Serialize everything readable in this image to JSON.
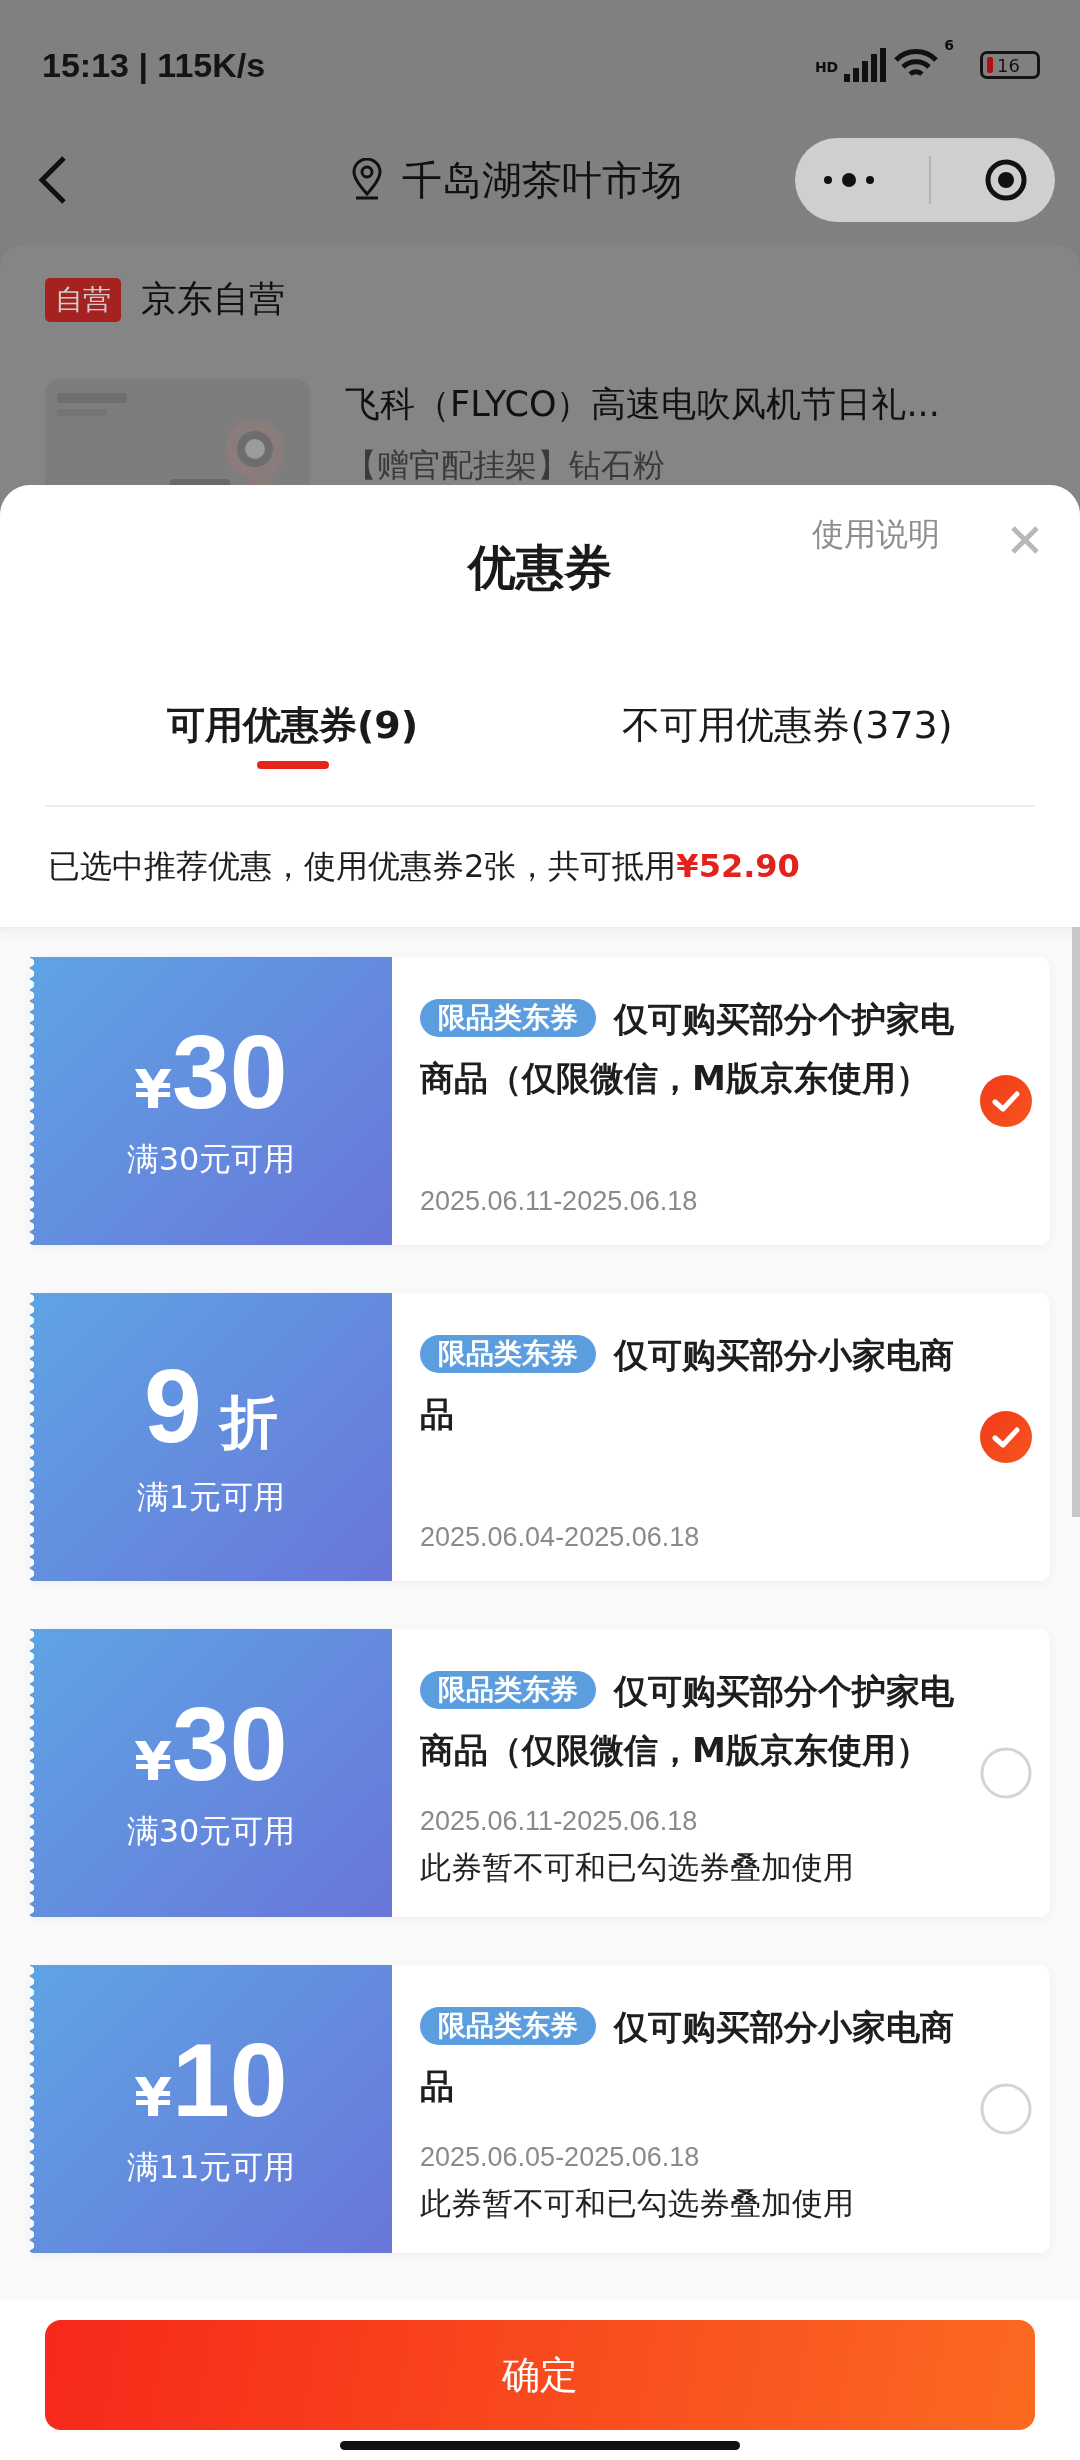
{
  "status_bar": {
    "time": "15:13 | 115K/s",
    "network": "HD",
    "wifi_badge": "6",
    "battery": "16"
  },
  "header": {
    "title": "千岛湖茶叶市场"
  },
  "background_page": {
    "badge": "自营",
    "store": "京东自营",
    "product": {
      "title": "飞科（FLYCO）高速电吹风机节日礼...",
      "subtitle": "【赠官配挂架】钻石粉"
    }
  },
  "sheet": {
    "help_link": "使用说明",
    "title": "优惠券",
    "tabs": [
      {
        "label": "可用优惠券(9)",
        "selected": true
      },
      {
        "label": "不可用优惠券(373)",
        "selected": false
      }
    ],
    "summary": {
      "text": "已选中推荐优惠，使用优惠券2张，共可抵用",
      "amount": "¥52.90"
    },
    "coupons": [
      {
        "kind": "cash",
        "currency": "¥",
        "amount": "30",
        "threshold": "满30元可用",
        "tag": "限品类东券",
        "title": "仅可购买部分个护家电商品（仅限微信，M版京东使用）",
        "date": "2025.06.11-2025.06.18",
        "selected": true
      },
      {
        "kind": "discount",
        "amount": "9",
        "unit": "折",
        "threshold": "满1元可用",
        "tag": "限品类东券",
        "title": "仅可购买部分小家电商品",
        "date": "2025.06.04-2025.06.18",
        "selected": true
      },
      {
        "kind": "cash",
        "currency": "¥",
        "amount": "30",
        "threshold": "满30元可用",
        "tag": "限品类东券",
        "title": "仅可购买部分个护家电商品（仅限微信，M版京东使用）",
        "date": "2025.06.11-2025.06.18",
        "note": "此券暂不可和已勾选券叠加使用",
        "selected": false
      },
      {
        "kind": "cash",
        "currency": "¥",
        "amount": "10",
        "threshold": "满11元可用",
        "tag": "限品类东券",
        "title": "仅可购买部分小家电商品",
        "date": "2025.06.05-2025.06.18",
        "note": "此券暂不可和已勾选券叠加使用",
        "selected": false
      }
    ],
    "confirm_button": "确定"
  }
}
